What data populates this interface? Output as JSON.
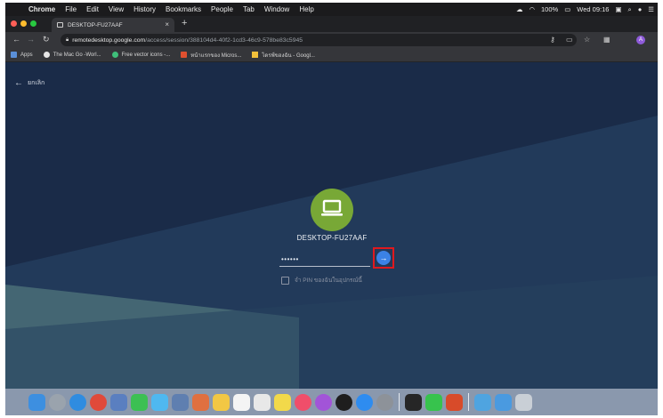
{
  "menubar": {
    "items": [
      "Chrome",
      "File",
      "Edit",
      "View",
      "History",
      "Bookmarks",
      "People",
      "Tab",
      "Window",
      "Help"
    ],
    "battery": "100%",
    "clock": "Wed 09:16"
  },
  "tab": {
    "title": "DESKTOP-FU27AAF"
  },
  "address": {
    "host": "remotedesktop.google.com",
    "path": "/access/session/388104d4-40f2-1cd3-46c9-578be83c5945"
  },
  "bookmarks": [
    "Apps",
    "The Mac Go -Worl...",
    "Free vector icons -...",
    "หน้าแรกของ Micros...",
    "ไดรฟ์ของฉัน - Googl..."
  ],
  "content": {
    "back_label": "ยกเลิก",
    "host_name": "DESKTOP-FU27AAF",
    "pin_value": "••••••",
    "remember_label": "จำ PIN ของฉันในอุปกรณ์นี้"
  },
  "colors": {
    "background": "#1b2c4a",
    "computer_icon_bg": "#78a836",
    "connect_button": "#3b82e6",
    "highlight": "#e0191e"
  },
  "dock": {
    "apps": [
      {
        "name": "finder-icon",
        "color": "#3d8fe0"
      },
      {
        "name": "launchpad-icon",
        "color": "#9aa3ad"
      },
      {
        "name": "safari-icon",
        "color": "#2f8ce0"
      },
      {
        "name": "chrome-icon",
        "color": "#e04a3a"
      },
      {
        "name": "preview-icon",
        "color": "#5a7fc0"
      },
      {
        "name": "facetime-icon",
        "color": "#3cc053"
      },
      {
        "name": "messages-icon",
        "color": "#4fb8f0"
      },
      {
        "name": "photos-app-icon",
        "color": "#5f7fb0"
      },
      {
        "name": "photos-icon",
        "color": "#e07040"
      },
      {
        "name": "notes-icon",
        "color": "#f2c744"
      },
      {
        "name": "calendar-icon",
        "color": "#f4f4f4"
      },
      {
        "name": "reminders-icon",
        "color": "#e8e8e8"
      },
      {
        "name": "stickies-icon",
        "color": "#f2d94a"
      },
      {
        "name": "music-icon",
        "color": "#f04e6a"
      },
      {
        "name": "podcasts-icon",
        "color": "#a254d8"
      },
      {
        "name": "apple-tv-icon",
        "color": "#1e1e1e"
      },
      {
        "name": "app-store-icon",
        "color": "#2e8cf0"
      },
      {
        "name": "system-preferences-icon",
        "color": "#8d9299"
      }
    ],
    "apps2": [
      {
        "name": "terminal-icon",
        "color": "#262626"
      },
      {
        "name": "line-icon",
        "color": "#37c34d"
      },
      {
        "name": "office-icon",
        "color": "#d84b2a"
      }
    ],
    "trays": [
      {
        "name": "folder-icon",
        "color": "#4fa4e0"
      },
      {
        "name": "downloads-icon",
        "color": "#4a9ae0"
      },
      {
        "name": "trash-icon",
        "color": "#c9cfd6"
      }
    ]
  }
}
